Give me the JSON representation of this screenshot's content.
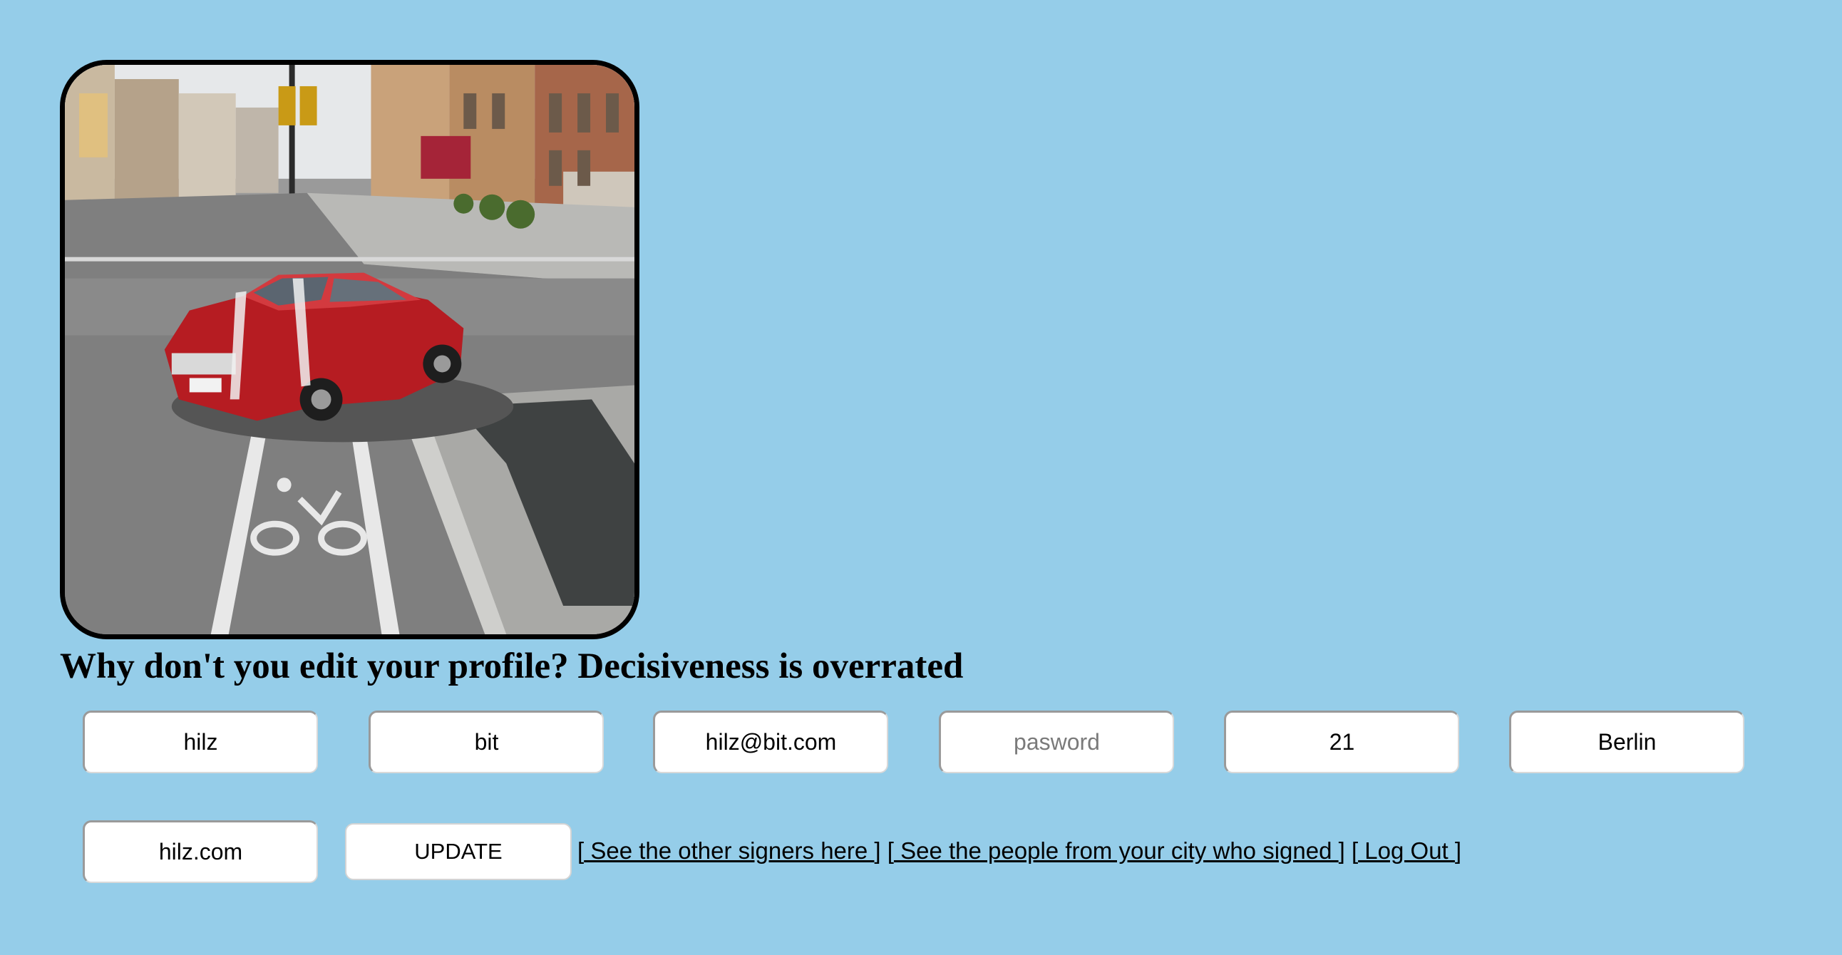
{
  "profile": {
    "image_alt": "Red car parked across a bike lane on a city street",
    "heading": "Why don't you edit your profile? Decisiveness is overrated"
  },
  "form": {
    "first_name": {
      "value": "hilz",
      "placeholder": ""
    },
    "last_name": {
      "value": "bit",
      "placeholder": ""
    },
    "email": {
      "value": "hilz@bit.com",
      "placeholder": ""
    },
    "password": {
      "value": "",
      "placeholder": "pasword"
    },
    "age": {
      "value": "21",
      "placeholder": ""
    },
    "city": {
      "value": "Berlin",
      "placeholder": ""
    },
    "url": {
      "value": "hilz.com",
      "placeholder": ""
    },
    "submit_label": "UPDATE"
  },
  "links": [
    {
      "text": " See the other signers here "
    },
    {
      "text": " See the people from your city who signed "
    },
    {
      "text": " Log Out "
    }
  ],
  "colors": {
    "background": "#95cde9",
    "frame_border": "#000000",
    "input_background": "#ffffff"
  }
}
